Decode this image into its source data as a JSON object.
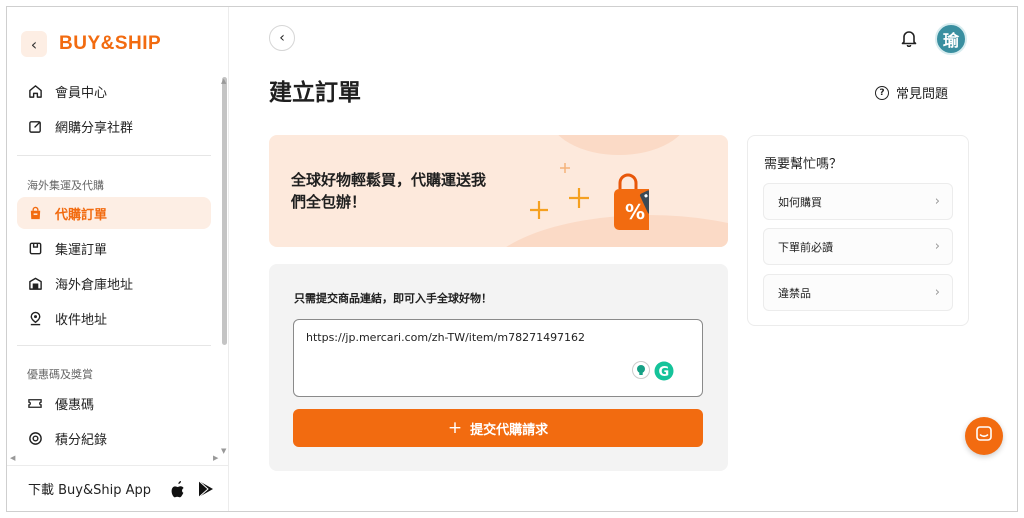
{
  "brand": {
    "logo_text": "BUY&SHIP",
    "accent": "#f26b10"
  },
  "sidebar": {
    "top_items": [
      {
        "label": "會員中心",
        "icon": "home-icon"
      },
      {
        "label": "網購分享社群",
        "icon": "edit-icon"
      }
    ],
    "section1_title": "海外集運及代購",
    "section1_items": [
      {
        "label": "代購訂單",
        "icon": "bag-icon",
        "active": true
      },
      {
        "label": "集運訂單",
        "icon": "box-icon"
      },
      {
        "label": "海外倉庫地址",
        "icon": "warehouse-icon"
      },
      {
        "label": "收件地址",
        "icon": "location-icon"
      }
    ],
    "section2_title": "優惠碼及獎賞",
    "section2_items": [
      {
        "label": "優惠碼",
        "icon": "ticket-icon"
      },
      {
        "label": "積分紀錄",
        "icon": "points-icon"
      }
    ],
    "download_label": "下載 Buy&Ship App"
  },
  "header": {
    "avatar_char": "瑜"
  },
  "main": {
    "title": "建立訂單",
    "faq_label": "常見問題",
    "banner_text": "全球好物輕鬆買，代購運送我們全包辦！",
    "form_label": "只需提交商品連結，即可入手全球好物！",
    "url_value": "https://jp.mercari.com/zh-TW/item/m78271497162",
    "submit_label": "提交代購請求"
  },
  "help": {
    "title": "需要幫忙嗎？",
    "items": [
      "如何購買",
      "下單前必讀",
      "違禁品"
    ]
  }
}
